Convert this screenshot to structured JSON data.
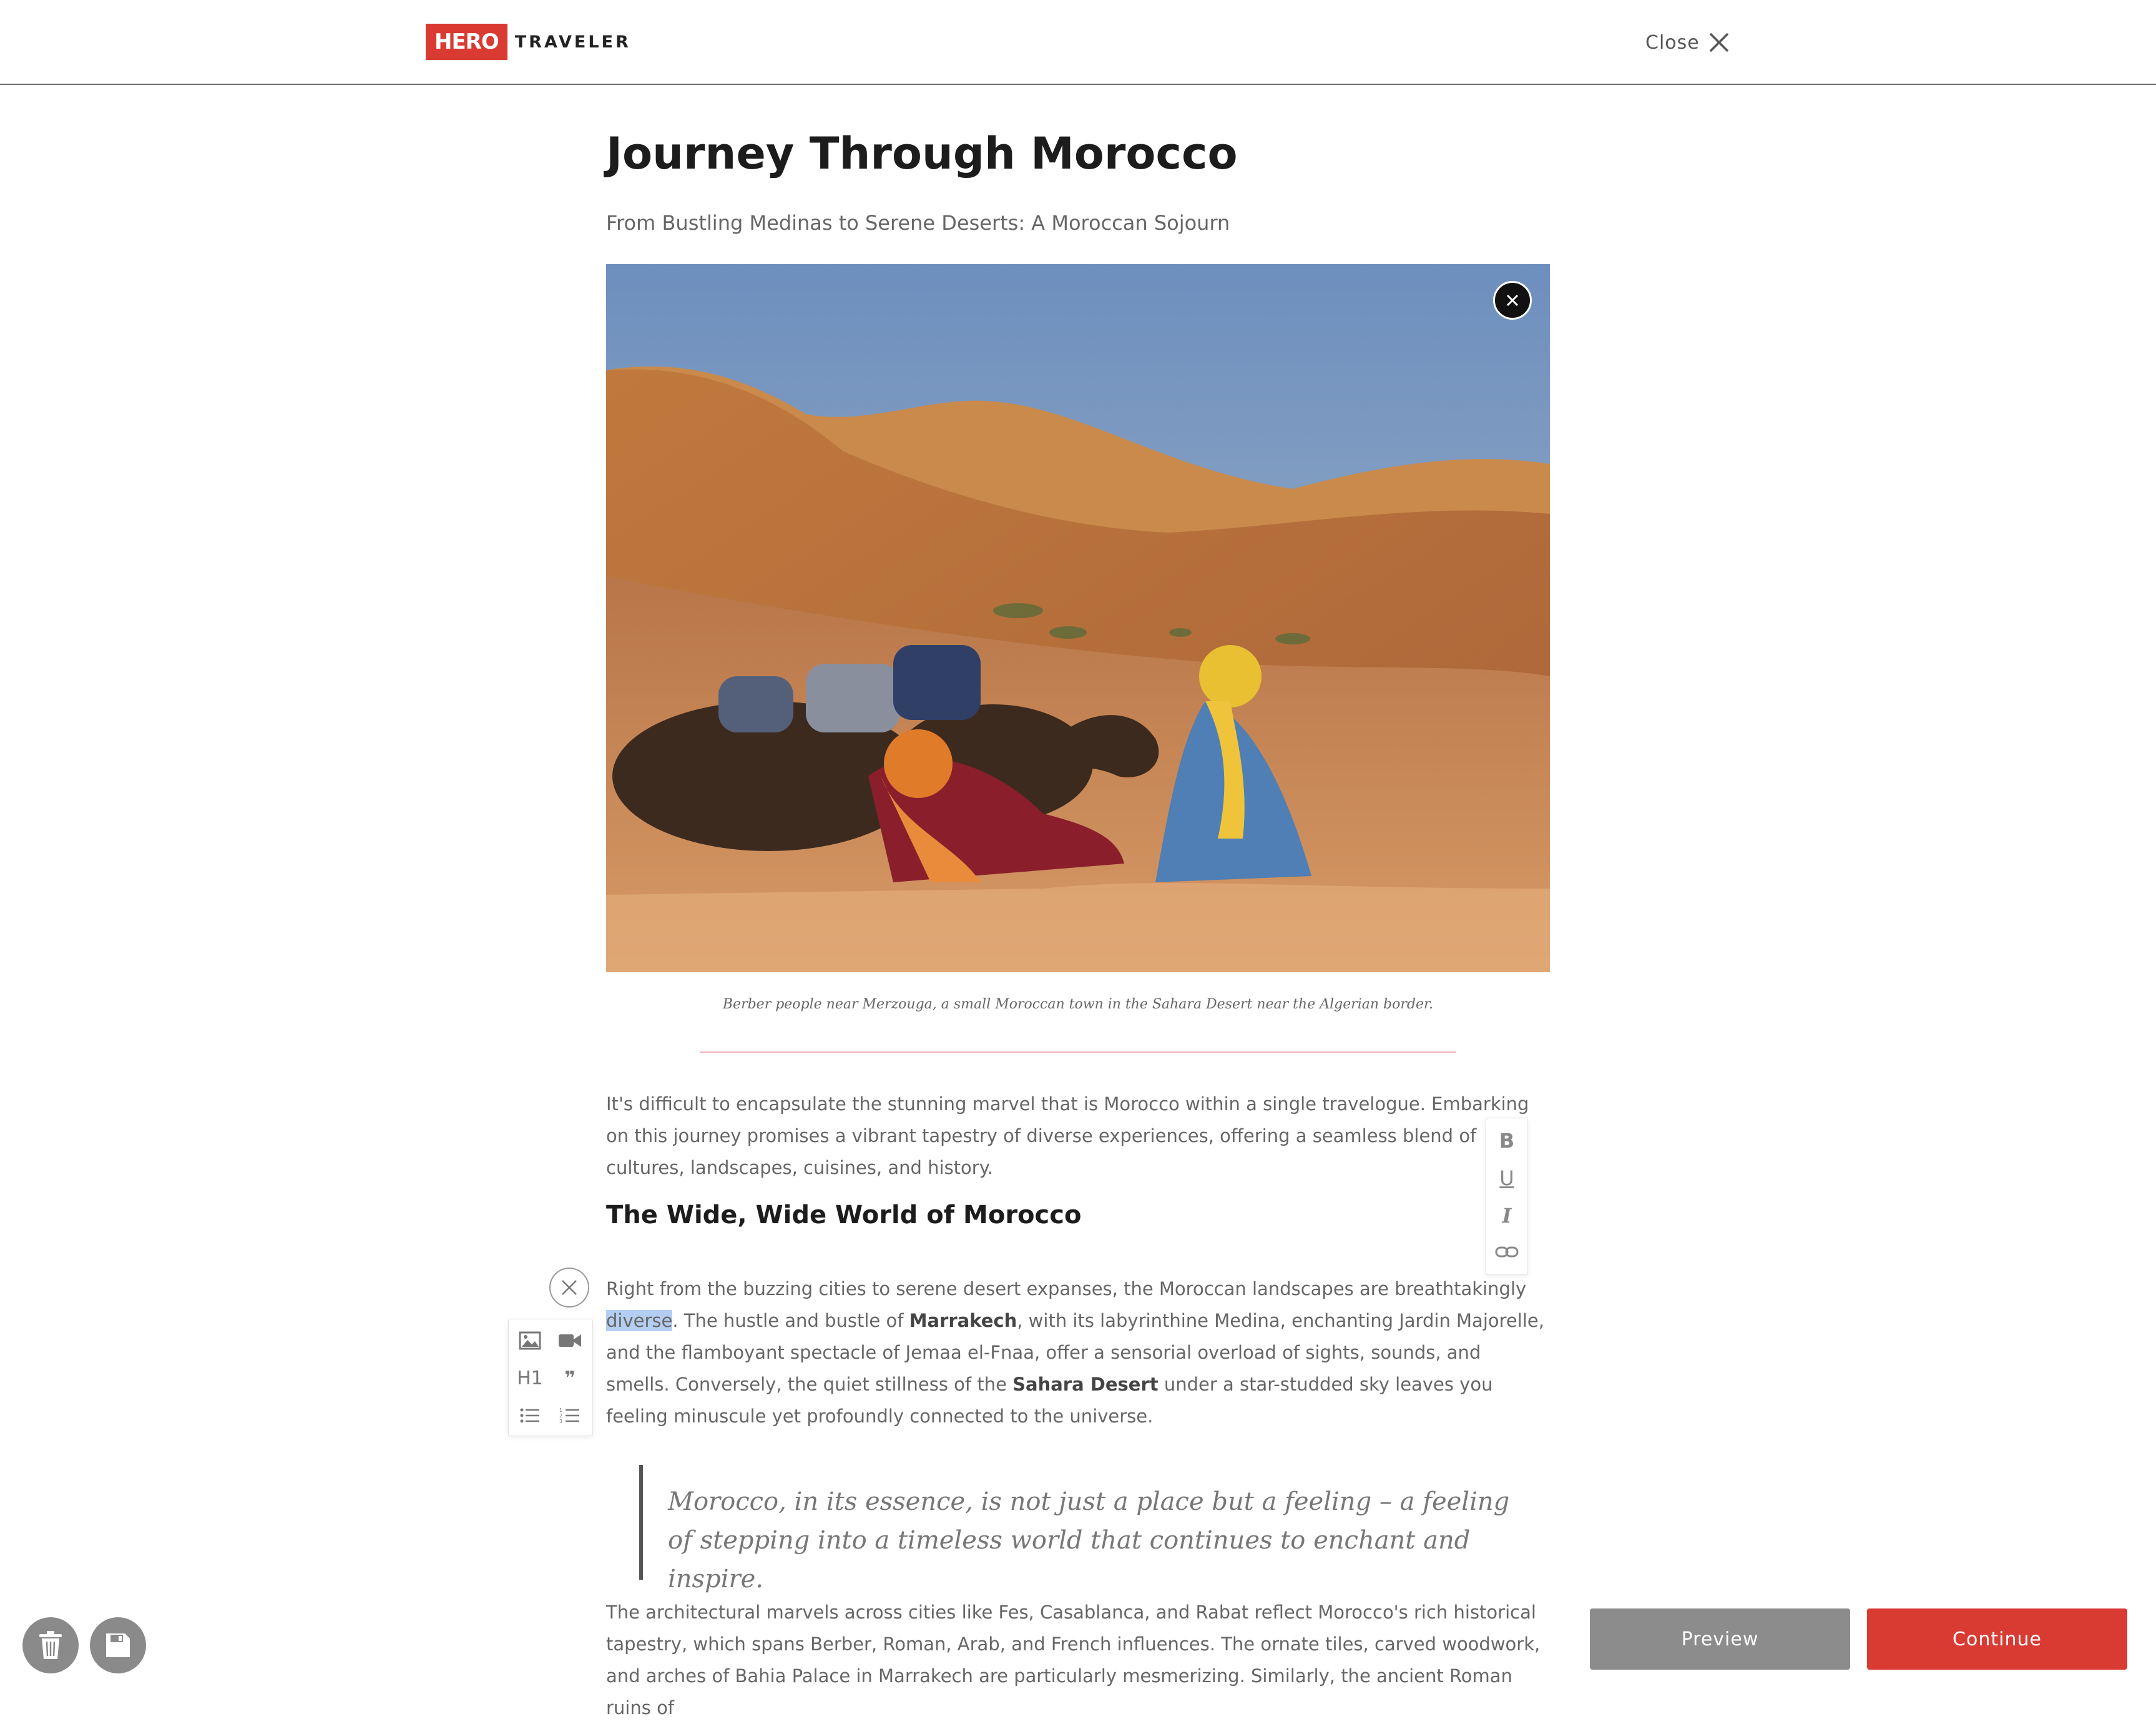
{
  "header": {
    "logo_hero": "HERO",
    "logo_traveler": "TRAVELER",
    "close_label": "Close"
  },
  "article": {
    "title": "Journey Through Morocco",
    "subtitle": "From Bustling Medinas to Serene Deserts: A Moroccan Sojourn",
    "image_caption": "Berber people near Merzouga, a small Moroccan town in the Sahara Desert near the Algerian border.",
    "paragraph1": "It's difficult to encapsulate the stunning marvel that is Morocco within a single travelogue. Embarking on this journey promises a vibrant tapestry of diverse experiences, offering a seamless blend of cultures, landscapes, cuisines, and history.",
    "heading1": "The Wide, Wide World of Morocco",
    "paragraph2": {
      "part1": "Right from the buzzing cities to serene desert expanses, the Moroccan landscapes are breathtakingly ",
      "selected": "diverse",
      "part2": ". The hustle and bustle of ",
      "bold1": "Marrakech",
      "part3": ", with its labyrinthine Medina, enchanting Jardin Majorelle, and the flamboyant spectacle of Jemaa el-Fnaa, offer a sensorial overload of sights, sounds, and smells. Conversely, the quiet stillness of the ",
      "bold2": "Sahara Desert",
      "part4": " under a star-studded sky leaves you feeling minuscule yet profoundly connected to the universe."
    },
    "quote": "Morocco, in its essence, is not just a place but a feeling – a feeling of stepping into a timeless world that continues to enchant and inspire.",
    "paragraph3": "The architectural marvels across cities like Fes, Casablanca, and Rabat reflect Morocco's rich historical tapestry, which spans Berber, Roman, Arab, and French influences. The ornate tiles, carved woodwork, and arches of Bahia Palace in Marrakech are particularly mesmerizing. Similarly, the ancient Roman ruins of"
  },
  "format_toolbar": {
    "bold": "B",
    "underline": "U",
    "italic": "I"
  },
  "insert_toolbar": {
    "heading": "H1",
    "quote": "❞"
  },
  "footer": {
    "preview_label": "Preview",
    "continue_label": "Continue"
  },
  "colors": {
    "brand_red": "#d93a32",
    "preview_gray": "#8c8c8c",
    "selection_blue": "#b4cdf2"
  }
}
